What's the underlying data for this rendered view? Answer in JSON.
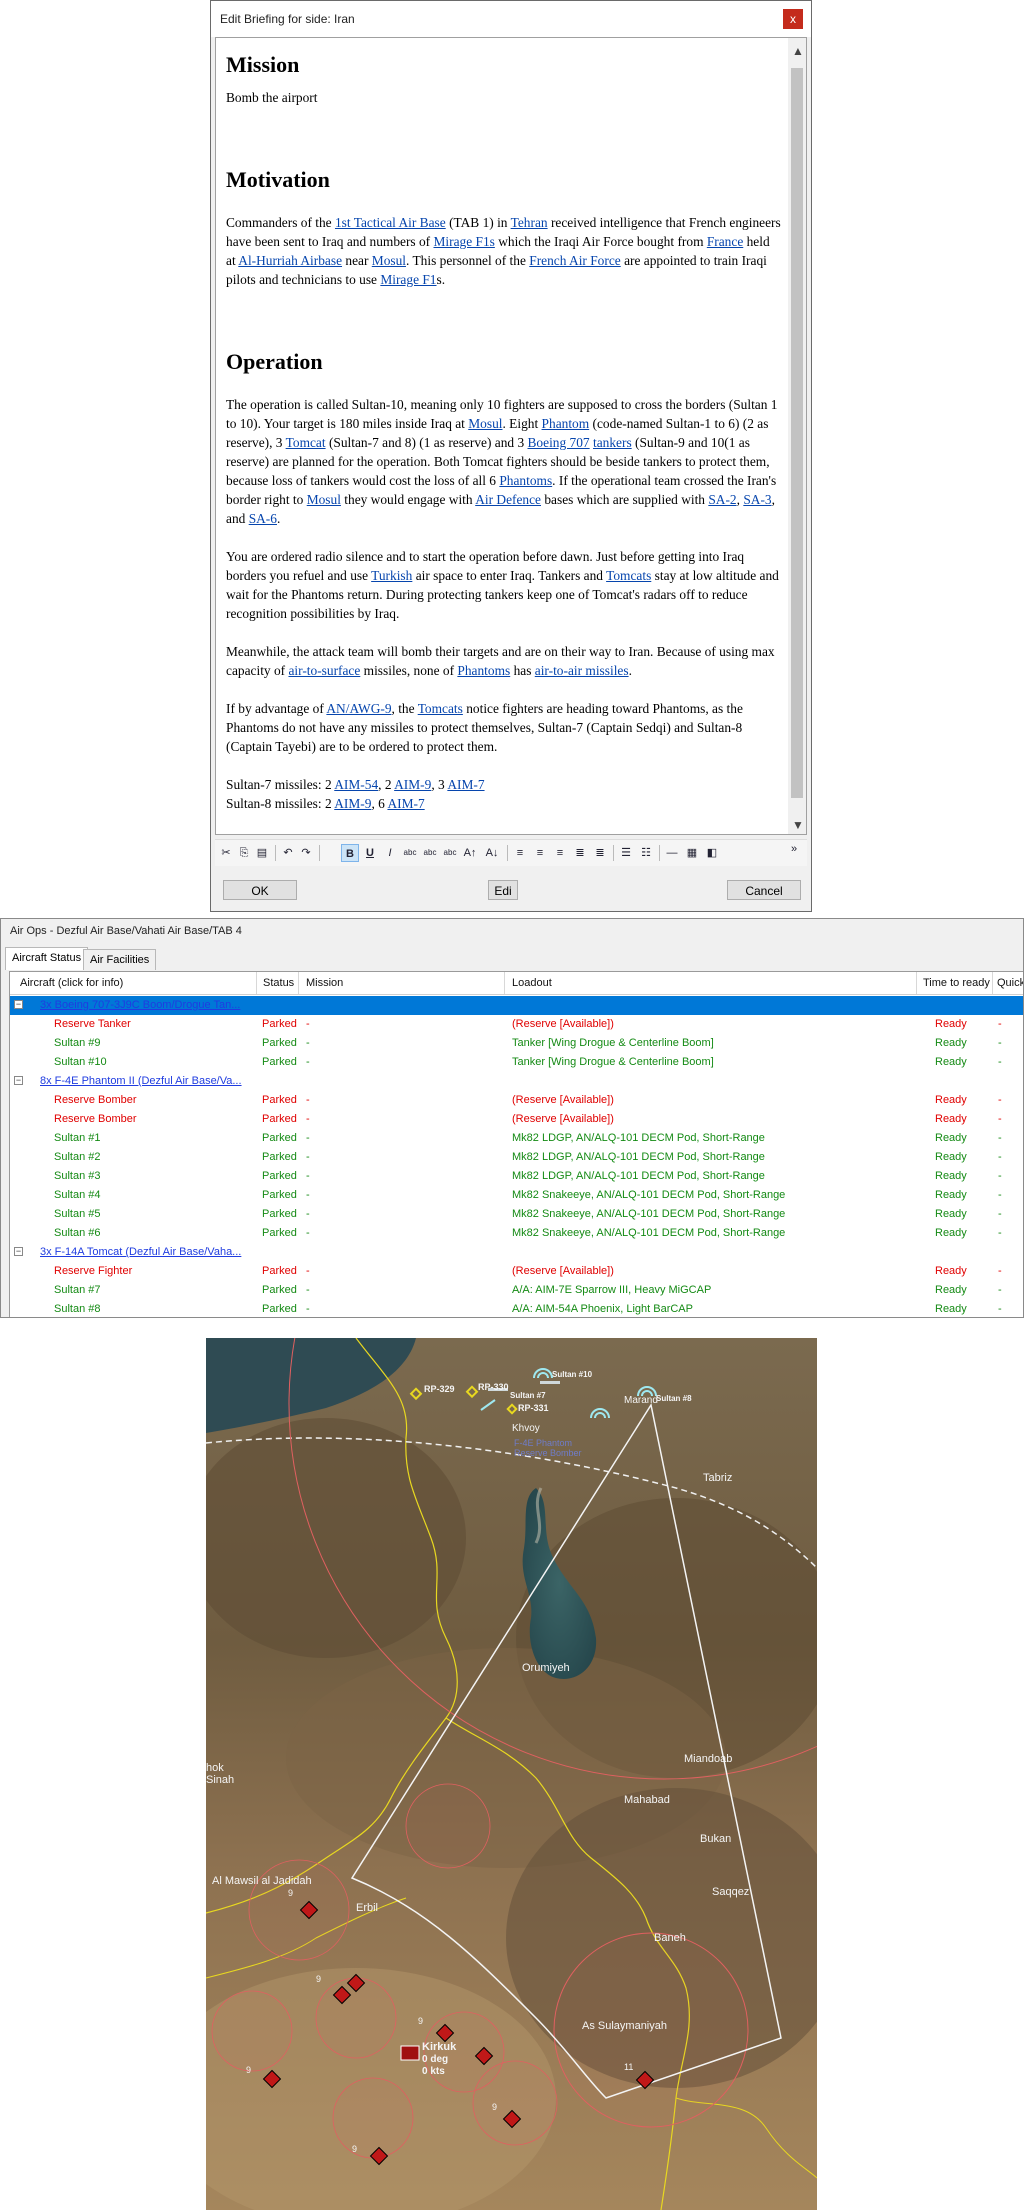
{
  "briefing": {
    "title": "Edit Briefing for side: Iran",
    "close": "x",
    "mission_heading": "Mission",
    "mission_text": "Bomb the airport",
    "motivation_heading": "Motivation",
    "operation_heading": "Operation",
    "links": {
      "tab1": "1st Tactical Air Base",
      "tehran": "Tehran",
      "mirage_f1s": "Mirage F1s",
      "france": "France",
      "al_hurriah": "Al-Hurriah Airbase",
      "mosul": "Mosul",
      "french_af": "French Air Force",
      "mirage_f1": "Mirage F1",
      "phantom": "Phantom",
      "tomcat": "Tomcat",
      "boeing": "Boeing 707",
      "tankers": "tankers",
      "phantoms": "Phantoms",
      "air_defence": "Air Defence",
      "sa2": "SA-2",
      "sa3": "SA-3",
      "sa6": "SA-6",
      "turkish": "Turkish",
      "tomcats": "Tomcats",
      "a2s": "air-to-surface",
      "a2a": "air-to-air missiles",
      "awg9": "AN/AWG-9",
      "aim54": "AIM-54",
      "aim9": "AIM-9",
      "aim7": "AIM-7"
    },
    "t": {
      "m1": "Commanders of the ",
      "m2": " (TAB 1) in ",
      "m3": " received intelligence that French engineers have been sent to Iraq and numbers of ",
      "m4": " which the Iraqi Air Force bought from ",
      "m5": " held at ",
      "m6": " near ",
      "m7": ". This personnel of the ",
      "m8": " are appointed to train Iraqi pilots and technicians to use ",
      "m9": "s.",
      "o1": "The operation is called Sultan-10, meaning only 10 fighters are supposed to cross the borders (Sultan 1 to 10). Your target is 180 miles inside Iraq at ",
      "o2": ". Eight ",
      "o3": " (code-named Sultan-1 to 6) (2 as reserve), 3 ",
      "o4": " (Sultan-7 and 8) (1 as reserve) and 3 ",
      "o5": " ",
      "o6": " (Sultan-9 and 10(1 as reserve) are planned for the operation. Both Tomcat fighters should be beside tankers to protect them, because loss of tankers would cost the loss of all 6 ",
      "o7": ". If the operational team crossed the Iran's border right to ",
      "o8": " they would engage with ",
      "o9": " bases which are supplied with ",
      "o10": ", ",
      "o11": ", and ",
      "o12": ".",
      "r1": "You are ordered radio silence and to start the operation before dawn. Just before getting into Iraq borders you refuel and use ",
      "r2": " air space to enter Iraq. Tankers and ",
      "r3": " stay at low altitude and wait for the Phantoms return. During protecting tankers keep one of Tomcat's radars off to reduce recognition possibilities by Iraq.",
      "w1": "Meanwhile, the attack team will bomb their targets and are on their way to Iran. Because of using max capacity of ",
      "w2": " missiles, none of ",
      "w3": " has ",
      "w4": ".",
      "a1": "If by advantage of ",
      "a2": ", the ",
      "a3": " notice fighters are heading toward Phantoms, as the Phantoms do not have any missiles to protect themselves, Sultan-7 (Captain Sedqi) and Sultan-8 (Captain Tayebi) are to be ordered to protect them.",
      "s7": "Sultan-7 missiles: 2 ",
      "s8": "Sultan-8 missiles: 2 ",
      "c2": ", 2 ",
      "c3": ", 3 ",
      "c6": ", 6 "
    },
    "toolbar": {
      "cut": "✂",
      "copy": "⎘",
      "paste": "📋",
      "undo": "↶",
      "redo": "↷",
      "bold": "B",
      "underline": "U",
      "italic": "I",
      "more": "»"
    },
    "ok": "OK",
    "edit": "Edi",
    "cancel": "Cancel"
  },
  "airops": {
    "title": "Air Ops - Dezful Air Base/Vahati Air Base/TAB 4",
    "tabs": [
      "Aircraft Status",
      "Air Facilities"
    ],
    "columns": [
      "Aircraft (click for info)",
      "Status",
      "Mission",
      "Loadout",
      "Time to ready",
      "Quick"
    ],
    "rows": [
      {
        "kind": "group",
        "name": "3x Boeing 707-3J9C Boom/Drogue Tan...",
        "toggle": "−"
      },
      {
        "kind": "item",
        "color": "red",
        "name": "Reserve Tanker",
        "status": "Parked",
        "mission": "-",
        "loadout": "(Reserve [Available])",
        "ready": "Ready",
        "quick": "-"
      },
      {
        "kind": "item",
        "color": "green",
        "name": "Sultan #9",
        "status": "Parked",
        "mission": "-",
        "loadout": "Tanker [Wing Drogue & Centerline Boom]",
        "ready": "Ready",
        "quick": "-"
      },
      {
        "kind": "item",
        "color": "green",
        "name": "Sultan #10",
        "status": "Parked",
        "mission": "-",
        "loadout": "Tanker [Wing Drogue & Centerline Boom]",
        "ready": "Ready",
        "quick": "-"
      },
      {
        "kind": "group",
        "name": "8x F-4E Phantom II (Dezful Air Base/Va...",
        "toggle": "−"
      },
      {
        "kind": "item",
        "color": "red",
        "name": "Reserve Bomber",
        "status": "Parked",
        "mission": "-",
        "loadout": "(Reserve [Available])",
        "ready": "Ready",
        "quick": "-"
      },
      {
        "kind": "item",
        "color": "red",
        "name": "Reserve Bomber",
        "status": "Parked",
        "mission": "-",
        "loadout": "(Reserve [Available])",
        "ready": "Ready",
        "quick": "-"
      },
      {
        "kind": "item",
        "color": "green",
        "name": "Sultan #1",
        "status": "Parked",
        "mission": "-",
        "loadout": "Mk82 LDGP, AN/ALQ-101 DECM Pod, Short-Range",
        "ready": "Ready",
        "quick": "-"
      },
      {
        "kind": "item",
        "color": "green",
        "name": "Sultan #2",
        "status": "Parked",
        "mission": "-",
        "loadout": "Mk82 LDGP, AN/ALQ-101 DECM Pod, Short-Range",
        "ready": "Ready",
        "quick": "-"
      },
      {
        "kind": "item",
        "color": "green",
        "name": "Sultan #3",
        "status": "Parked",
        "mission": "-",
        "loadout": "Mk82 LDGP, AN/ALQ-101 DECM Pod, Short-Range",
        "ready": "Ready",
        "quick": "-"
      },
      {
        "kind": "item",
        "color": "green",
        "name": "Sultan #4",
        "status": "Parked",
        "mission": "-",
        "loadout": "Mk82 Snakeeye, AN/ALQ-101 DECM Pod, Short-Range",
        "ready": "Ready",
        "quick": "-"
      },
      {
        "kind": "item",
        "color": "green",
        "name": "Sultan #5",
        "status": "Parked",
        "mission": "-",
        "loadout": "Mk82 Snakeeye, AN/ALQ-101 DECM Pod, Short-Range",
        "ready": "Ready",
        "quick": "-"
      },
      {
        "kind": "item",
        "color": "green",
        "name": "Sultan #6",
        "status": "Parked",
        "mission": "-",
        "loadout": "Mk82 Snakeeye, AN/ALQ-101 DECM Pod, Short-Range",
        "ready": "Ready",
        "quick": "-"
      },
      {
        "kind": "group",
        "name": "3x F-14A Tomcat (Dezful Air Base/Vaha...",
        "toggle": "−"
      },
      {
        "kind": "item",
        "color": "red",
        "name": "Reserve Fighter",
        "status": "Parked",
        "mission": "-",
        "loadout": "(Reserve [Available])",
        "ready": "Ready",
        "quick": "-"
      },
      {
        "kind": "item",
        "color": "green",
        "name": "Sultan #7",
        "status": "Parked",
        "mission": "-",
        "loadout": "A/A: AIM-7E Sparrow III, Heavy MiGCAP",
        "ready": "Ready",
        "quick": "-"
      },
      {
        "kind": "item",
        "color": "green",
        "name": "Sultan #8",
        "status": "Parked",
        "mission": "-",
        "loadout": "A/A: AIM-54A Phoenix, Light BarCAP",
        "ready": "Ready",
        "quick": "-"
      }
    ],
    "selected_row": 0
  },
  "map": {
    "colors": {
      "range_ring": "#e06060",
      "border": "#e8d820",
      "arc": "#f4f4f4",
      "sam": "#c01818"
    },
    "labels": {
      "rp329": "RP-329",
      "rp330": "RP-330",
      "rp331": "RP-331",
      "sultan7": "Sultan #7",
      "sultan10": "Sultan #10",
      "sultan8": "Sultan #8",
      "khvoy": "Khvoy",
      "marand": "Marand",
      "tabriz": "Tabriz",
      "orumiyeh": "Orumiyeh",
      "miandoab": "Miandoab",
      "mahabad": "Mahabad",
      "bukan": "Bukan",
      "saqqez": "Saqqez",
      "baneh": "Baneh",
      "erbil": "Erbil",
      "mosul": "Al Mawsil al Jadidah",
      "suly": "As Sulaymaniyah",
      "kirkuk": "Kirkuk",
      "hok": "hok",
      "sinah": "Sinah",
      "tanker_label": "F-4E Phantom",
      "tanker_label2": "Reserve Bomber",
      "deg": "0 deg",
      "kts": "0 kts"
    },
    "sam_counts": [
      "9",
      "9",
      "9",
      "9",
      "9",
      "9",
      "9",
      "11"
    ]
  }
}
